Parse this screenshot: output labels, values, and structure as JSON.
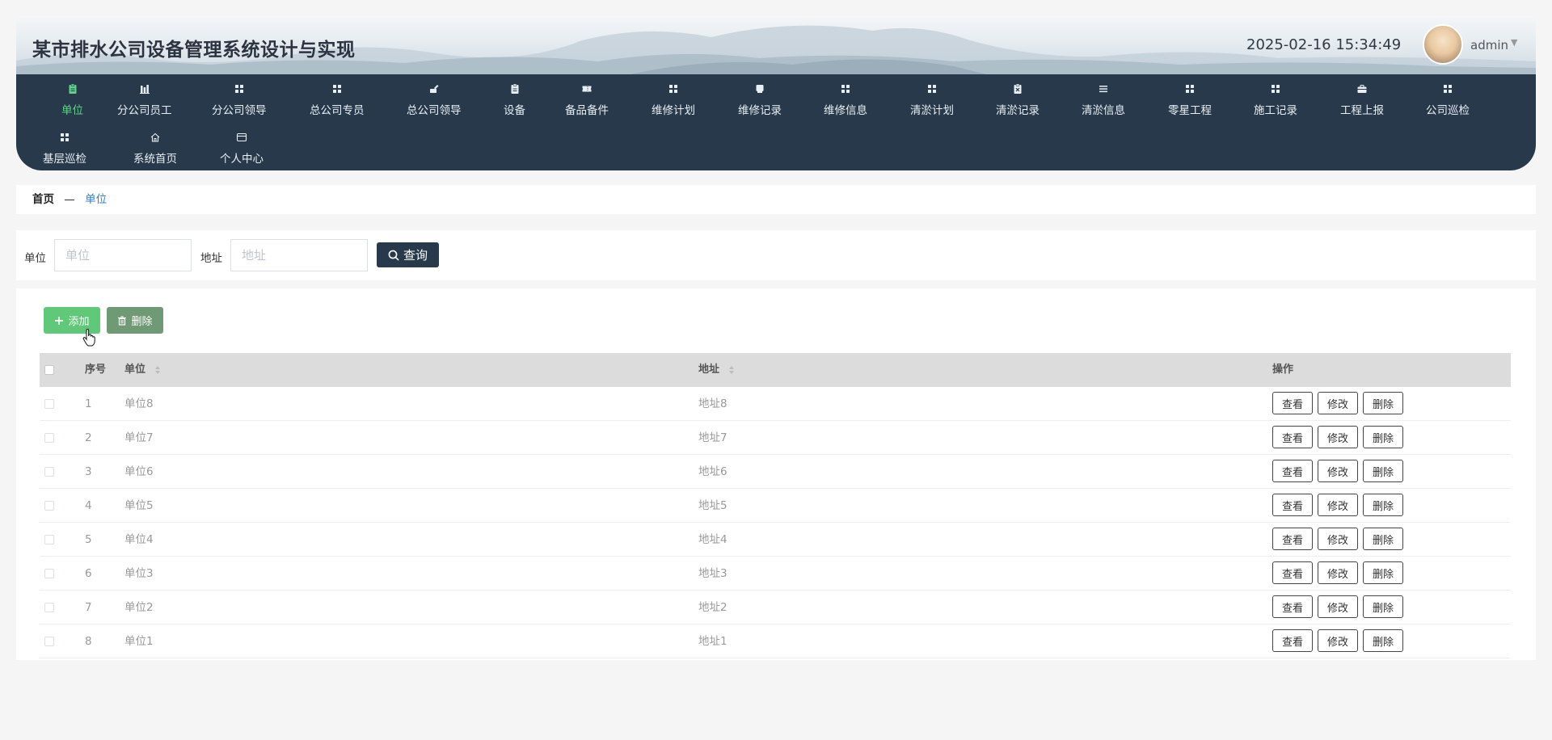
{
  "header": {
    "title": "某市排水公司设备管理系统设计与实现",
    "datetime": "2025-02-16 15:34:49",
    "username": "admin"
  },
  "nav": {
    "items": [
      {
        "label": "单位",
        "icon": "clipboard-icon",
        "active": true
      },
      {
        "label": "分公司员工",
        "icon": "bar-chart-icon"
      },
      {
        "label": "分公司领导",
        "icon": "grid-icon"
      },
      {
        "label": "总公司专员",
        "icon": "grid-icon"
      },
      {
        "label": "总公司领导",
        "icon": "pen-icon"
      },
      {
        "label": "设备",
        "icon": "clipboard-icon"
      },
      {
        "label": "备品备件",
        "icon": "ticket-icon"
      },
      {
        "label": "维修计划",
        "icon": "grid-icon"
      },
      {
        "label": "维修记录",
        "icon": "note-icon"
      },
      {
        "label": "维修信息",
        "icon": "grid-icon"
      },
      {
        "label": "清淤计划",
        "icon": "grid-icon"
      },
      {
        "label": "清淤记录",
        "icon": "clipboard-x-icon"
      },
      {
        "label": "清淤信息",
        "icon": "list-icon"
      },
      {
        "label": "零星工程",
        "icon": "grid-icon"
      },
      {
        "label": "施工记录",
        "icon": "grid-icon"
      },
      {
        "label": "工程上报",
        "icon": "briefcase-icon"
      },
      {
        "label": "公司巡检",
        "icon": "grid-icon"
      },
      {
        "label": "基层巡检",
        "icon": "grid-icon"
      },
      {
        "label": "系统首页",
        "icon": "home-icon"
      },
      {
        "label": "个人中心",
        "icon": "card-icon"
      }
    ]
  },
  "breadcrumb": {
    "home": "首页",
    "separator": "—",
    "current": "单位"
  },
  "search": {
    "unit_label": "单位",
    "unit_placeholder": "单位",
    "unit_value": "",
    "address_label": "地址",
    "address_placeholder": "地址",
    "address_value": "",
    "button_label": "查询"
  },
  "toolbar": {
    "add_label": "添加",
    "delete_label": "删除"
  },
  "table": {
    "columns": {
      "index": "序号",
      "unit": "单位",
      "address": "地址",
      "actions": "操作"
    },
    "action_labels": {
      "view": "查看",
      "edit": "修改",
      "delete": "删除"
    },
    "rows": [
      {
        "index": "1",
        "unit": "单位8",
        "address": "地址8"
      },
      {
        "index": "2",
        "unit": "单位7",
        "address": "地址7"
      },
      {
        "index": "3",
        "unit": "单位6",
        "address": "地址6"
      },
      {
        "index": "4",
        "unit": "单位5",
        "address": "地址5"
      },
      {
        "index": "5",
        "unit": "单位4",
        "address": "地址4"
      },
      {
        "index": "6",
        "unit": "单位3",
        "address": "地址3"
      },
      {
        "index": "7",
        "unit": "单位2",
        "address": "地址2"
      },
      {
        "index": "8",
        "unit": "单位1",
        "address": "地址1"
      }
    ]
  },
  "colors": {
    "nav_bg": "#27394a",
    "nav_active": "#5fd28b",
    "add_button": "#5fc879",
    "delete_button": "#6f9a73",
    "breadcrumb_link": "#2c7fd0"
  }
}
